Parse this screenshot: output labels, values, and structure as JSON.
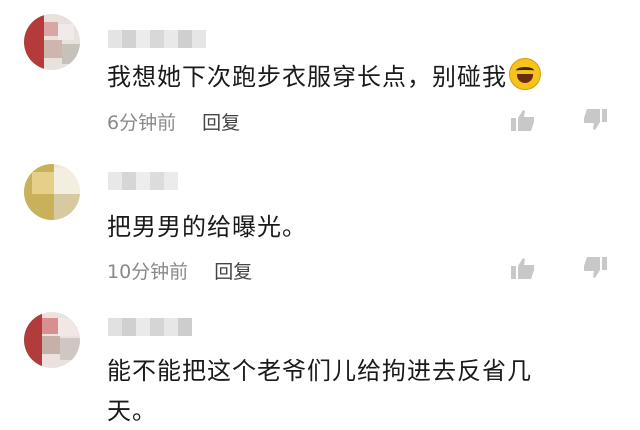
{
  "comments": [
    {
      "text": "我想她下次跑步衣服穿长点，别碰我",
      "emoji": "rolling-laughing-emoji",
      "time": "6分钟前",
      "reply": "回复"
    },
    {
      "text": "把男男的给曝光。",
      "time": "10分钟前",
      "reply": "回复"
    },
    {
      "text_line1": "能不能把这个老爷们儿给拘进去反省几",
      "text_line2": "天。"
    }
  ],
  "icons": {
    "like": "thumbs-up-icon",
    "dislike": "thumbs-down-icon"
  },
  "colors": {
    "meta_text": "#8a8a8a",
    "body_text": "#1a1a1a",
    "action_icon": "#c8c8c8"
  }
}
